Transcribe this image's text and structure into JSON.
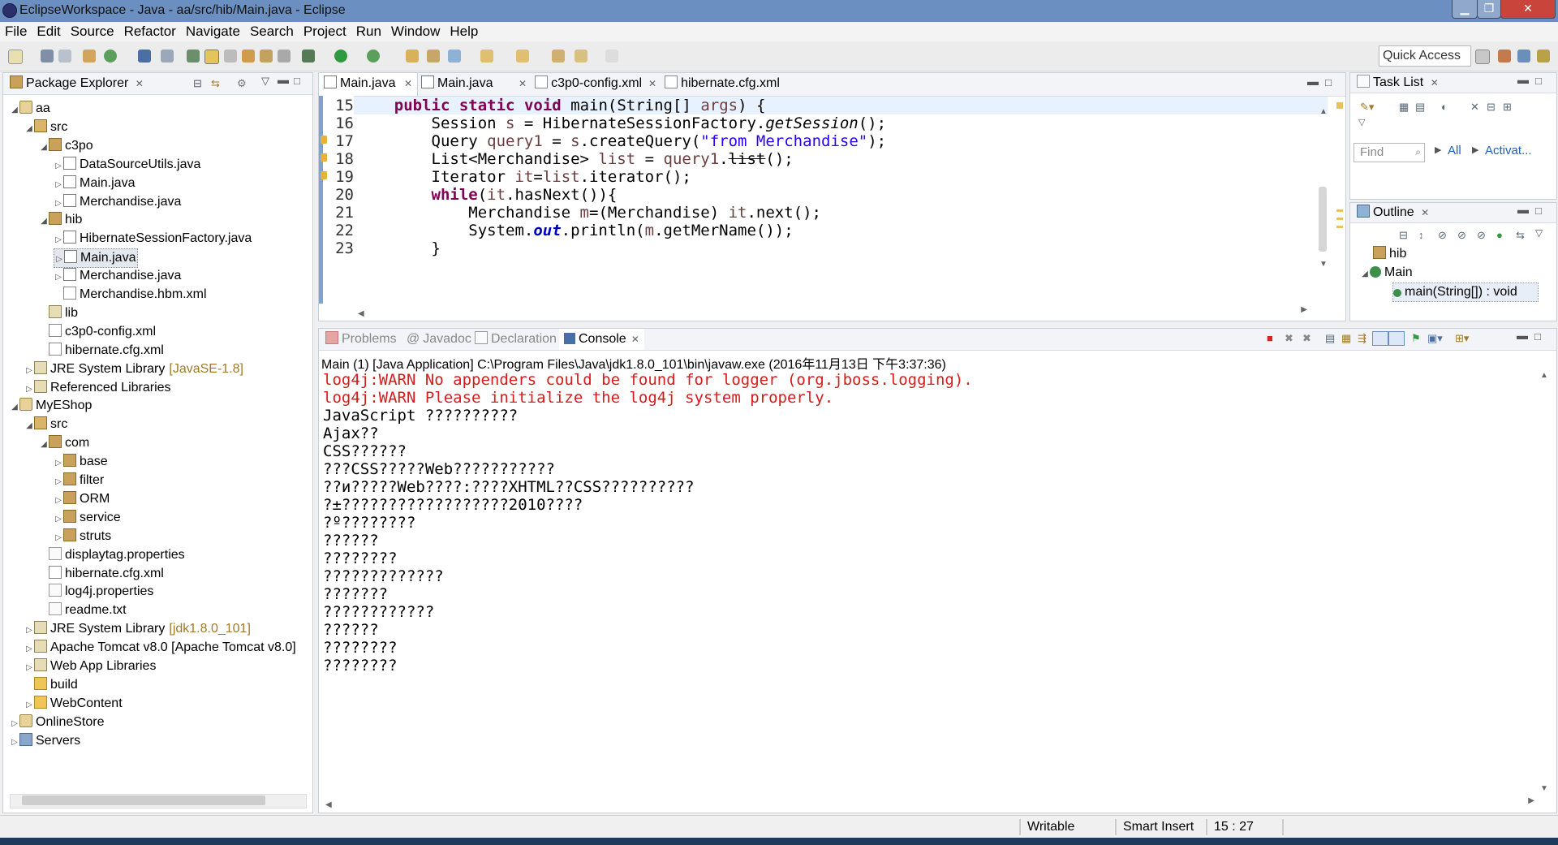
{
  "window": {
    "title": "EclipseWorkspace - Java - aa/src/hib/Main.java - Eclipse",
    "min": "▁",
    "max": "❐",
    "close": "✕"
  },
  "menu": [
    "File",
    "Edit",
    "Source",
    "Refactor",
    "Navigate",
    "Search",
    "Project",
    "Run",
    "Window",
    "Help"
  ],
  "toolbar": {
    "quick_access": "Quick Access"
  },
  "package_explorer": {
    "title": "Package Explorer",
    "rows": [
      {
        "label": "aa",
        "arrow": "◢",
        "icon": "proj",
        "indent": 0
      },
      {
        "label": "src",
        "arrow": "◢",
        "icon": "src",
        "indent": 1
      },
      {
        "label": "c3po",
        "arrow": "◢",
        "icon": "pkg",
        "indent": 2
      },
      {
        "label": "DataSourceUtils.java",
        "arrow": "▷",
        "icon": "java",
        "indent": 3
      },
      {
        "label": "Main.java",
        "arrow": "▷",
        "icon": "java",
        "indent": 3
      },
      {
        "label": "Merchandise.java",
        "arrow": "▷",
        "icon": "java",
        "indent": 3
      },
      {
        "label": "hib",
        "arrow": "◢",
        "icon": "pkg",
        "indent": 2
      },
      {
        "label": "HibernateSessionFactory.java",
        "arrow": "▷",
        "icon": "java",
        "indent": 3
      },
      {
        "label": "Main.java",
        "arrow": "▷",
        "icon": "java",
        "indent": 3,
        "selected": true
      },
      {
        "label": "Merchandise.java",
        "arrow": "▷",
        "icon": "java",
        "indent": 3
      },
      {
        "label": "Merchandise.hbm.xml",
        "arrow": "",
        "icon": "xml",
        "indent": 3
      },
      {
        "label": "lib",
        "arrow": "",
        "icon": "lib",
        "indent": 2
      },
      {
        "label": "c3p0-config.xml",
        "arrow": "",
        "icon": "xml",
        "indent": 2
      },
      {
        "label": "hibernate.cfg.xml",
        "arrow": "",
        "icon": "xml",
        "indent": 2
      },
      {
        "label": "JRE System Library",
        "suffix": "[JavaSE-1.8]",
        "arrow": "▷",
        "icon": "lib",
        "indent": 1
      },
      {
        "label": "Referenced Libraries",
        "arrow": "▷",
        "icon": "lib",
        "indent": 1
      },
      {
        "label": "MyEShop",
        "arrow": "◢",
        "icon": "proj",
        "indent": 0
      },
      {
        "label": "src",
        "arrow": "◢",
        "icon": "src",
        "indent": 1
      },
      {
        "label": "com",
        "arrow": "◢",
        "icon": "pkg",
        "indent": 2
      },
      {
        "label": "base",
        "arrow": "▷",
        "icon": "pkg",
        "indent": 3
      },
      {
        "label": "filter",
        "arrow": "▷",
        "icon": "pkg",
        "indent": 3
      },
      {
        "label": "ORM",
        "arrow": "▷",
        "icon": "pkg",
        "indent": 3
      },
      {
        "label": "service",
        "arrow": "▷",
        "icon": "pkg",
        "indent": 3
      },
      {
        "label": "struts",
        "arrow": "▷",
        "icon": "pkg",
        "indent": 3
      },
      {
        "label": "displaytag.properties",
        "arrow": "",
        "icon": "txt",
        "indent": 2
      },
      {
        "label": "hibernate.cfg.xml",
        "arrow": "",
        "icon": "xml",
        "indent": 2
      },
      {
        "label": "log4j.properties",
        "arrow": "",
        "icon": "txt",
        "indent": 2
      },
      {
        "label": "readme.txt",
        "arrow": "",
        "icon": "txt",
        "indent": 2
      },
      {
        "label": "JRE System Library",
        "suffix": "[jdk1.8.0_101]",
        "arrow": "▷",
        "icon": "lib",
        "indent": 1
      },
      {
        "label": "Apache Tomcat v8.0 [Apache Tomcat v8.0]",
        "arrow": "▷",
        "icon": "lib",
        "indent": 1
      },
      {
        "label": "Web App Libraries",
        "arrow": "▷",
        "icon": "lib",
        "indent": 1
      },
      {
        "label": "build",
        "arrow": "",
        "icon": "folder",
        "indent": 1
      },
      {
        "label": "WebContent",
        "arrow": "▷",
        "icon": "folder",
        "indent": 1
      },
      {
        "label": "OnlineStore",
        "arrow": "▷",
        "icon": "proj",
        "indent": 0
      },
      {
        "label": "Servers",
        "arrow": "▷",
        "icon": "server",
        "indent": 0
      }
    ]
  },
  "editor": {
    "tabs": [
      "Main.java",
      "Main.java",
      "c3p0-config.xml",
      "hibernate.cfg.xml"
    ],
    "lines": [
      {
        "num": "15",
        "html": "    <span class='kw'>public</span> <span class='kw'>static</span> <span class='kw'>void</span> main(String[] <span class='var'>args</span>) {"
      },
      {
        "num": "16",
        "html": "        Session <span class='var'>s</span> = HibernateSessionFactory.<span class='ital'>getSession</span>();"
      },
      {
        "num": "17",
        "html": "        Query <span class='var'>query1</span> = <span class='var'>s</span>.createQuery(<span class='str'>\"from Merchandise\"</span>);"
      },
      {
        "num": "18",
        "html": "        List&lt;Merchandise&gt; <span class='var'>list</span> = <span class='var'>query1</span>.<span class='strike'>list</span>();"
      },
      {
        "num": "19",
        "html": "        Iterator <span class='var'>it</span>=<span class='var'>list</span>.iterator();"
      },
      {
        "num": "20",
        "html": "        <span class='kw'>while</span>(<span class='var'>it</span>.hasNext()){"
      },
      {
        "num": "21",
        "html": "            Merchandise <span class='var'>m</span>=(Merchandise) <span class='var'>it</span>.next();"
      },
      {
        "num": "22",
        "html": "            System.<span class='fld'>out</span>.println(<span class='var'>m</span>.getMerName());"
      },
      {
        "num": "23",
        "html": "        }"
      }
    ]
  },
  "tasklist": {
    "title": "Task List",
    "find_placeholder": "Find",
    "all": "All",
    "activate": "Activat..."
  },
  "outline": {
    "title": "Outline",
    "items": [
      "hib",
      "Main",
      "main(String[]) : void"
    ]
  },
  "bottom": {
    "tabs": [
      "Problems",
      "Javadoc",
      "Declaration",
      "Console"
    ],
    "launch": "Main (1) [Java Application] C:\\Program Files\\Java\\jdk1.8.0_101\\bin\\javaw.exe (2016年11月13日 下午3:37:36)",
    "console": [
      {
        "text": "log4j:WARN No appenders could be found for logger (org.jboss.logging).",
        "err": true
      },
      {
        "text": "log4j:WARN Please initialize the log4j system properly.",
        "err": true
      },
      {
        "text": "JavaScript ??????????",
        "err": false
      },
      {
        "text": "Ajax??",
        "err": false
      },
      {
        "text": "CSS??????",
        "err": false
      },
      {
        "text": "???CSS?????Web???????????",
        "err": false
      },
      {
        "text": "??и?????Web????:????XHTML??CSS??????????",
        "err": false
      },
      {
        "text": "?±??????????????????2010????",
        "err": false
      },
      {
        "text": "?º????????",
        "err": false
      },
      {
        "text": "??????",
        "err": false
      },
      {
        "text": "????????",
        "err": false
      },
      {
        "text": "?????????????",
        "err": false
      },
      {
        "text": "???????",
        "err": false
      },
      {
        "text": "????????????",
        "err": false
      },
      {
        "text": "??????",
        "err": false
      },
      {
        "text": "????????",
        "err": false
      },
      {
        "text": "????????",
        "err": false
      }
    ]
  },
  "status": {
    "writable": "Writable",
    "insert": "Smart Insert",
    "pos": "15 : 27"
  }
}
